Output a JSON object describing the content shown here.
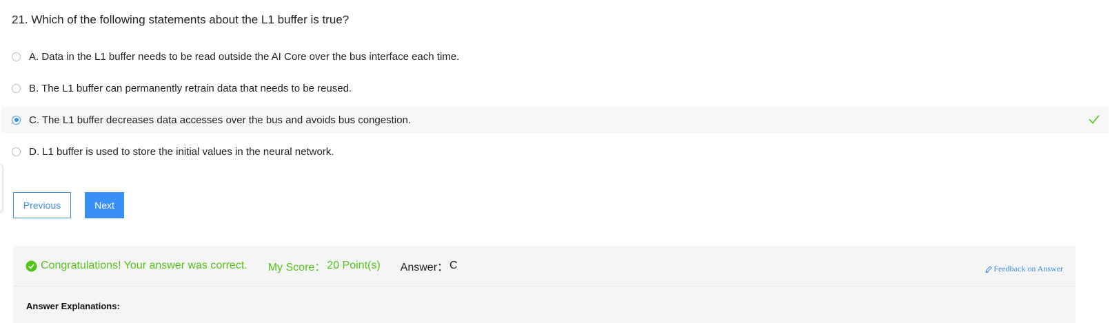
{
  "question": {
    "title": "21. Which of the following statements about the L1 buffer is true?"
  },
  "options": [
    {
      "label": "A. Data in the L1 buffer needs to be read outside the AI Core over the bus interface each time.",
      "selected": false
    },
    {
      "label": "B. The L1 buffer can permanently retrain data that needs to be reused.",
      "selected": false
    },
    {
      "label": "C. The L1 buffer decreases data accesses over the bus and avoids bus congestion.",
      "selected": true,
      "correct": true
    },
    {
      "label": "D. L1 buffer is used to store the initial values in the neural network.",
      "selected": false
    }
  ],
  "nav": {
    "previous_label": "Previous",
    "next_label": "Next"
  },
  "result": {
    "status_icon": "check-circle-icon",
    "message": "Congratulations! Your answer was correct.",
    "score_label": "My Score：",
    "score_value": "20 Point(s)",
    "answer_label": "Answer：",
    "answer_value": "C",
    "feedback_label": "Feedback on Answer",
    "explanation_title": "Answer Explanations:"
  },
  "colors": {
    "accent": "#3d8fe6",
    "success": "#52c41a",
    "panel_bg": "#f5f5f5"
  }
}
